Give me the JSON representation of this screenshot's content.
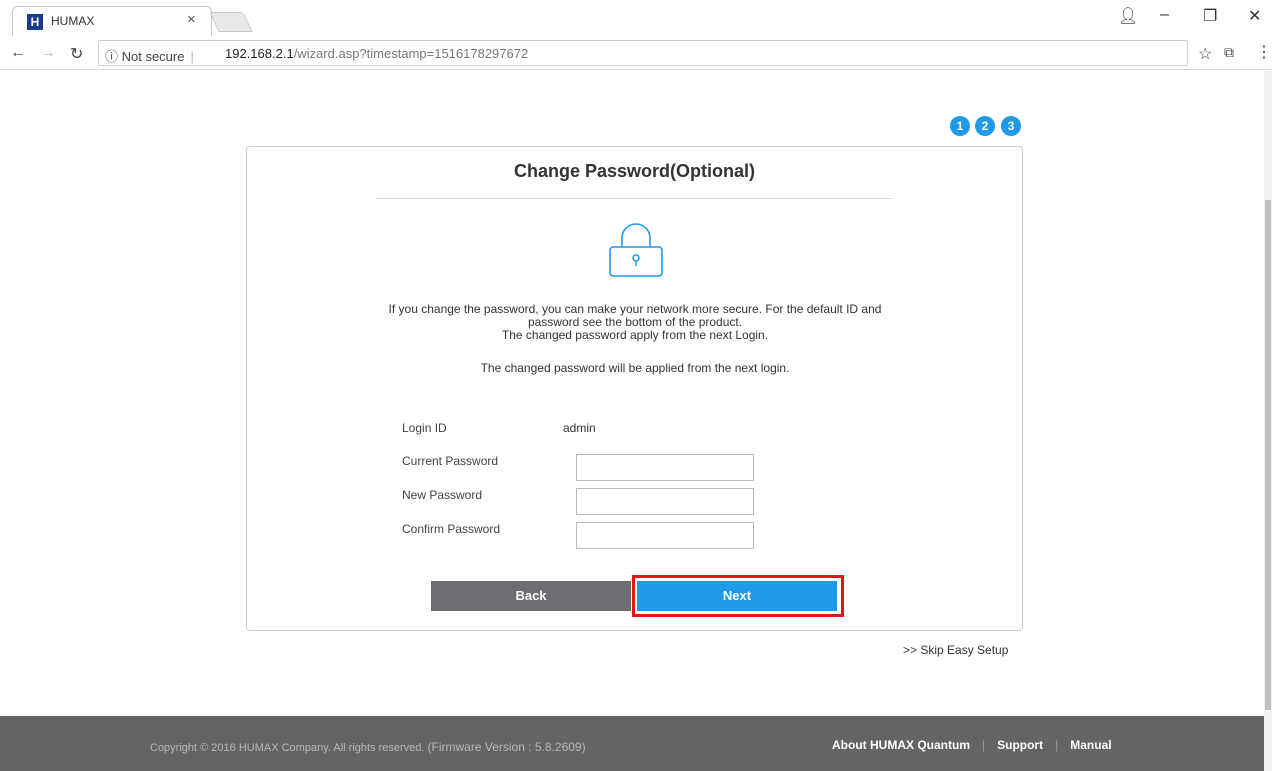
{
  "browser": {
    "tab_title": "HUMAX",
    "tab_favicon": "H",
    "tab_close": "×",
    "security_label": "ⓘ Not secure",
    "url_host": "192.168.2.1",
    "url_path": "/wizard.asp?timestamp=1516178297672"
  },
  "steps": [
    "1",
    "2",
    "3"
  ],
  "card": {
    "title": "Change Password(Optional)",
    "description_lines": [
      "If you change the password, you can make your network more secure. For the default ID and",
      "password see the bottom of the product.",
      "The changed password apply from the next Login."
    ],
    "note": "The changed password will be applied from the next login.",
    "fields": {
      "login_id_label": "Login ID",
      "login_id_value": "admin",
      "current_password_label": "Current Password",
      "new_password_label": "New Password",
      "confirm_password_label": "Confirm Password"
    },
    "back_label": "Back",
    "next_label": "Next"
  },
  "skip_label": ">> Skip Easy Setup",
  "footer": {
    "copyright": "Copyright © 2016 HUMAX Company. All rights reserved.",
    "firmware": "(Firmware Version : 5.8.2609)",
    "links": [
      "About HUMAX Quantum",
      "Support",
      "Manual"
    ]
  },
  "colors": {
    "accent": "#1e9ae9",
    "back_button": "#6d6e71",
    "highlight": "#e2151b",
    "footer": "#636466"
  },
  "icons": [
    "lock-icon",
    "back-arrow-icon",
    "forward-arrow-icon",
    "reload-icon",
    "star-icon",
    "cast-icon",
    "menu-icon",
    "account-icon"
  ]
}
